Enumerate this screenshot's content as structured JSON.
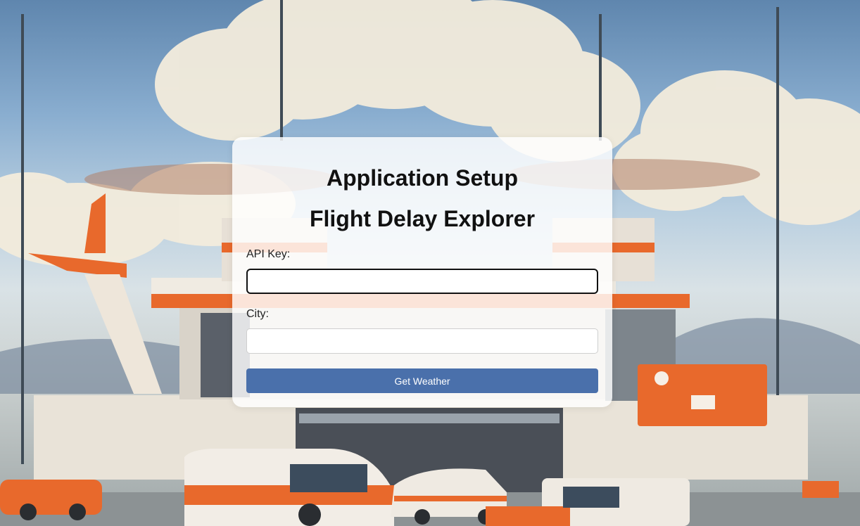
{
  "card": {
    "title": "Application Setup",
    "subtitle": "Flight Delay Explorer",
    "api_key_label": "API Key:",
    "api_key_value": "",
    "city_label": "City:",
    "city_value": "",
    "button_label": "Get Weather"
  },
  "colors": {
    "button": "#4a70ab",
    "accent_orange": "#e8692c"
  }
}
